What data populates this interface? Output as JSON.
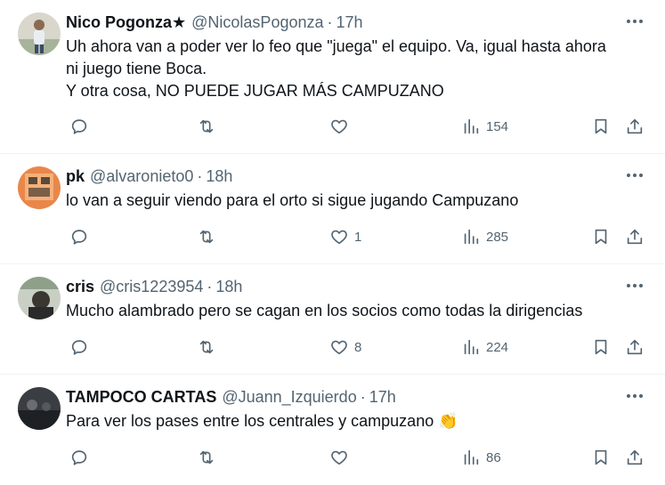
{
  "tweets": [
    {
      "name": "Nico Pogonza★",
      "handle": "@NicolasPogonza",
      "dot": "·",
      "time": "17h",
      "text": "Uh ahora van a poder ver lo feo que \"juega\" el equipo. Va, igual hasta ahora\nni juego tiene Boca.\nY otra cosa, NO PUEDE JUGAR MÁS CAMPUZANO",
      "likes": "",
      "views": "154",
      "avatar_color": "#7a8f6b"
    },
    {
      "name": "pk",
      "handle": "@alvaronieto0",
      "dot": "·",
      "time": "18h",
      "text": "lo van a seguir viendo para el orto si sigue jugando Campuzano",
      "likes": "1",
      "views": "285",
      "avatar_color": "#e07a3a"
    },
    {
      "name": "cris",
      "handle": "@cris1223954",
      "dot": "·",
      "time": "18h",
      "text": "Mucho alambrado pero se cagan en los socios como todas la dirigencias",
      "likes": "8",
      "views": "224",
      "avatar_color": "#4a5a48"
    },
    {
      "name": "TAMPOCO CARTAS",
      "handle": "@Juann_Izquierdo",
      "dot": "·",
      "time": "17h",
      "text": "Para ver los pases entre los centrales y campuzano 👏",
      "likes": "",
      "views": "86",
      "avatar_color": "#2e3236"
    }
  ],
  "icons": {
    "more": "more-horizontal-icon",
    "reply": "reply-icon",
    "retweet": "retweet-icon",
    "like": "heart-icon",
    "views": "views-chart-icon",
    "bookmark": "bookmark-icon",
    "share": "share-icon"
  },
  "colors": {
    "text": "#0f1419",
    "secondary": "#536471",
    "divider": "#eff3f4"
  }
}
